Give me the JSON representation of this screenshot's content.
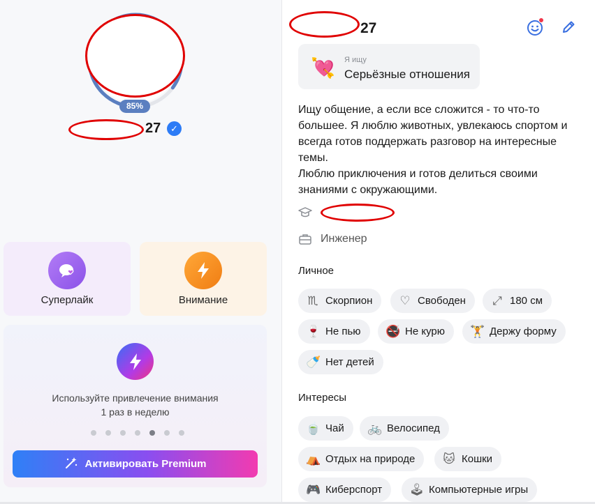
{
  "left": {
    "percent": "85%",
    "age": "27",
    "cards": {
      "superlike_label": "Суперлайк",
      "attention_label": "Внимание"
    },
    "promo": {
      "line1": "Используйте привлечение внимания",
      "line2": "1 раз в неделю",
      "dots_total": 7,
      "dot_active_index": 4,
      "button_label": "Активировать Premium"
    }
  },
  "right": {
    "age": "27",
    "seeking": {
      "small": "Я ищу",
      "main": "Серьёзные отношения"
    },
    "about": "Ищу общение, а если все сложится - то что-то\nбольшее. Я люблю животных, увлекаюсь спортом и\nвсегда готов поддержать разговор на интересные\nтемы.\nЛюблю приключения и готов делиться своими\nзнаниями с окружающими.",
    "job": "Инженер",
    "personal_title": "Личное",
    "personal": [
      {
        "icon": "scorpio-icon",
        "glyph": "♏",
        "label": "Скорпион"
      },
      {
        "icon": "heart-icon",
        "glyph": "♡",
        "label": "Свободен"
      },
      {
        "icon": "height-icon",
        "glyph": "⤢",
        "label": "180 см"
      },
      {
        "icon": "glass-icon",
        "glyph": "🍷",
        "label": "Не пью"
      },
      {
        "icon": "no-smoking-icon",
        "glyph": "🚭",
        "label": "Не курю"
      },
      {
        "icon": "dumbbell-icon",
        "glyph": "🏋",
        "label": "Держу форму"
      },
      {
        "icon": "baby-bottle-icon",
        "glyph": "🍼",
        "label": "Нет детей"
      }
    ],
    "interests_title": "Интересы",
    "interests": [
      {
        "icon": "tea-icon",
        "glyph": "🍵",
        "label": "Чай"
      },
      {
        "icon": "bicycle-icon",
        "glyph": "🚲",
        "label": "Велосипед"
      },
      {
        "icon": "camping-icon",
        "glyph": "⛺",
        "label": "Отдых на природе"
      },
      {
        "icon": "cat-icon",
        "glyph": "🐱",
        "label": "Кошки"
      },
      {
        "icon": "gamepad-icon",
        "glyph": "🎮",
        "label": "Киберспорт"
      },
      {
        "icon": "joystick-icon",
        "glyph": "🕹",
        "label": "Компьютерные игры"
      }
    ]
  }
}
